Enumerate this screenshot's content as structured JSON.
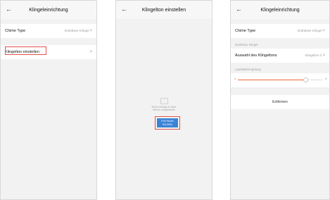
{
  "screen1": {
    "title": "Klingeleinrichtung",
    "back_icon": "arrow-left-icon",
    "rows": [
      {
        "label": "Chime Type",
        "value": "Drahtlose Klingel"
      },
      {
        "label": "Klingelton einstellen",
        "value": ""
      }
    ]
  },
  "screen2": {
    "title": "Klingelton einstellen",
    "empty_text": "Nicht verfügt es über keinen angepaarte",
    "pair_button": "EIN PAAR BILDEN"
  },
  "screen3": {
    "title": "Klingeleinrichtung",
    "chime_row": {
      "label": "Chime Type",
      "value": "Drahtlose Klingel"
    },
    "section1": "Drahtlose Klingel",
    "ringtone_row": {
      "label": "Auswahl des Klingeltons",
      "value": "Klingelton 2"
    },
    "section2": "Lautstärkeregelung",
    "volume": {
      "min": "1",
      "max": "4",
      "level": 0.8
    },
    "delete_label": "Entfernen"
  },
  "colors": {
    "highlight": "#e0534d",
    "accent": "#3b83d6",
    "slider": "#e96a2b"
  }
}
